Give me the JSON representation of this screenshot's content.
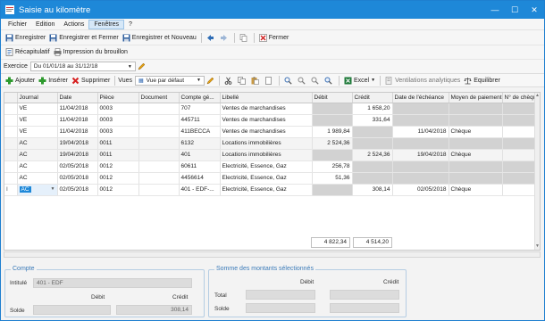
{
  "window": {
    "title": "Saisie au kilomètre",
    "minimize": "—",
    "maximize": "☐",
    "close": "✕"
  },
  "menu": [
    "Fichier",
    "Edition",
    "Actions",
    "Fenêtres",
    "?"
  ],
  "toolbar1": {
    "save": "Enregistrer",
    "save_close": "Enregistrer et Fermer",
    "save_new": "Enregistrer et Nouveau",
    "close": "Fermer"
  },
  "toolbar2": {
    "recap": "Récapitulatif",
    "print_draft": "Impression du brouillon"
  },
  "exercise": {
    "label": "Exercice",
    "value": "Du 01/01/18 au 31/12/18"
  },
  "toolbar4": {
    "add": "Ajouter",
    "insert": "Insérer",
    "delete": "Supprimer",
    "views": "Vues",
    "view_value": "Vue par défaut",
    "excel": "Excel",
    "ventilations": "Ventilations analytiques",
    "balance": "Equilibrer"
  },
  "grid": {
    "columns": [
      "Journal",
      "Date",
      "Pièce",
      "Document",
      "Compte gé...",
      "Libellé",
      "Débit",
      "Crédit",
      "Date de l'échéance",
      "Moyen de paiement",
      "N° de chèque"
    ],
    "rows": [
      {
        "journal": "VE",
        "date": "11/04/2018",
        "piece": "0003",
        "document": "",
        "compte": "707",
        "libelle": "Ventes de marchandises",
        "debit": "",
        "credit": "1 658,20",
        "echeance": "",
        "moyen": "",
        "cheque": ""
      },
      {
        "journal": "VE",
        "date": "11/04/2018",
        "piece": "0003",
        "document": "",
        "compte": "445711",
        "libelle": "Ventes de marchandises",
        "debit": "",
        "credit": "331,64",
        "echeance": "",
        "moyen": "",
        "cheque": ""
      },
      {
        "journal": "VE",
        "date": "11/04/2018",
        "piece": "0003",
        "document": "",
        "compte": "411BECCA",
        "libelle": "Ventes de marchandises",
        "debit": "1 989,84",
        "credit": "",
        "echeance": "11/04/2018",
        "moyen": "Chèque",
        "cheque": ""
      },
      {
        "journal": "AC",
        "date": "19/04/2018",
        "piece": "0011",
        "document": "",
        "compte": "6132",
        "libelle": "Locations immobilières",
        "debit": "2 524,36",
        "credit": "",
        "echeance": "",
        "moyen": "",
        "cheque": ""
      },
      {
        "journal": "AC",
        "date": "19/04/2018",
        "piece": "0011",
        "document": "",
        "compte": "401",
        "libelle": "Locations immobilières",
        "debit": "",
        "credit": "2 524,36",
        "echeance": "19/04/2018",
        "moyen": "Chèque",
        "cheque": ""
      },
      {
        "journal": "AC",
        "date": "02/05/2018",
        "piece": "0012",
        "document": "",
        "compte": "60611",
        "libelle": "Electricité, Essence, Gaz",
        "debit": "256,78",
        "credit": "",
        "echeance": "",
        "moyen": "",
        "cheque": ""
      },
      {
        "journal": "AC",
        "date": "02/05/2018",
        "piece": "0012",
        "document": "",
        "compte": "4456614",
        "libelle": "Electricité, Essence, Gaz",
        "debit": "51,36",
        "credit": "",
        "echeance": "",
        "moyen": "",
        "cheque": ""
      },
      {
        "journal": "AC",
        "date": "02/05/2018",
        "piece": "0012",
        "document": "",
        "compte": "401 - EDF-...",
        "libelle": "Electricité, Essence, Gaz",
        "debit": "",
        "credit": "308,14",
        "echeance": "02/05/2018",
        "moyen": "Chèque",
        "cheque": ""
      }
    ],
    "row_indicator": "I",
    "total_debit": "4 822,34",
    "total_credit": "4 514,20"
  },
  "compte_panel": {
    "title": "Compte",
    "intitule_label": "Intitulé",
    "intitule_value": "401 - EDF",
    "debit_label": "Débit",
    "credit_label": "Crédit",
    "solde_label": "Solde",
    "solde_credit": "308,14"
  },
  "somme_panel": {
    "title": "Somme des montants sélectionnés",
    "debit_label": "Débit",
    "credit_label": "Crédit",
    "total_label": "Total",
    "solde_label": "Solde"
  }
}
